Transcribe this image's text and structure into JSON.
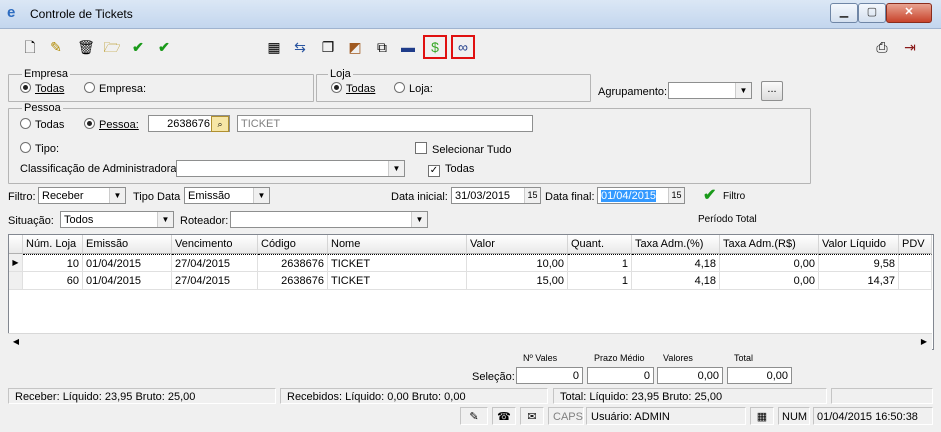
{
  "window": {
    "title": "Controle de Tickets"
  },
  "filters": {
    "empresa_label": "Empresa",
    "empresa_todas": "Todas",
    "empresa_opt": "Empresa:",
    "loja_label": "Loja",
    "loja_todas": "Todas",
    "loja_opt": "Loja:",
    "agrupamento_label": "Agrupamento:",
    "agrupamento_value": "",
    "pessoa_label": "Pessoa",
    "pessoa_todas": "Todas",
    "pessoa_opt": "Pessoa:",
    "pessoa_code": "2638676",
    "pessoa_name": "TICKET",
    "tipo_label": "Tipo:",
    "selecionar_tudo": "Selecionar Tudo",
    "todas_check": "Todas",
    "classificacao_label": "Classificação de Administradora:",
    "classificacao_value": "",
    "filtro_label": "Filtro:",
    "filtro_value": "Receber",
    "tipo_data_label": "Tipo Data",
    "tipo_data_value": "Emissão",
    "data_inicial_label": "Data inicial:",
    "data_inicial": "31/03/2015",
    "data_final_label": "Data final:",
    "data_final": "01/04/2015",
    "filtro_btn": "Filtro",
    "periodo_total": "Período Total",
    "situacao_label": "Situação:",
    "situacao_value": "Todos",
    "roteador_label": "Roteador:",
    "roteador_value": ""
  },
  "grid": {
    "columns": [
      "Núm. Loja",
      "Emissão",
      "Vencimento",
      "Código",
      "Nome",
      "Valor",
      "Quant.",
      "Taxa Adm.(%)",
      "Taxa Adm.(R$)",
      "Valor Líquido",
      "PDV"
    ],
    "rows": [
      [
        "10",
        "01/04/2015",
        "27/04/2015",
        "2638676",
        "TICKET",
        "10,00",
        "1",
        "4,18",
        "0,00",
        "9,58",
        ""
      ],
      [
        "60",
        "01/04/2015",
        "27/04/2015",
        "2638676",
        "TICKET",
        "15,00",
        "1",
        "4,18",
        "0,00",
        "14,37",
        ""
      ]
    ]
  },
  "selection": {
    "label": "Seleção:",
    "vales_label": "Nº Vales",
    "vales": "0",
    "prazo_label": "Prazo Médio",
    "prazo": "0",
    "valores_label": "Valores",
    "valores": "0,00",
    "total_label": "Total",
    "total": "0,00"
  },
  "summary": {
    "receber": "Receber:   Líquido: 23,95   Bruto: 25,00",
    "recebidos": "Recebidos:   Líquido: 0,00   Bruto: 0,00",
    "total": "Total:   Líquido: 23,95   Bruto: 25,00"
  },
  "status": {
    "caps": "CAPS",
    "user": "Usuário: ADMIN",
    "num": "NUM",
    "datetime": "01/04/2015 16:50:38"
  }
}
